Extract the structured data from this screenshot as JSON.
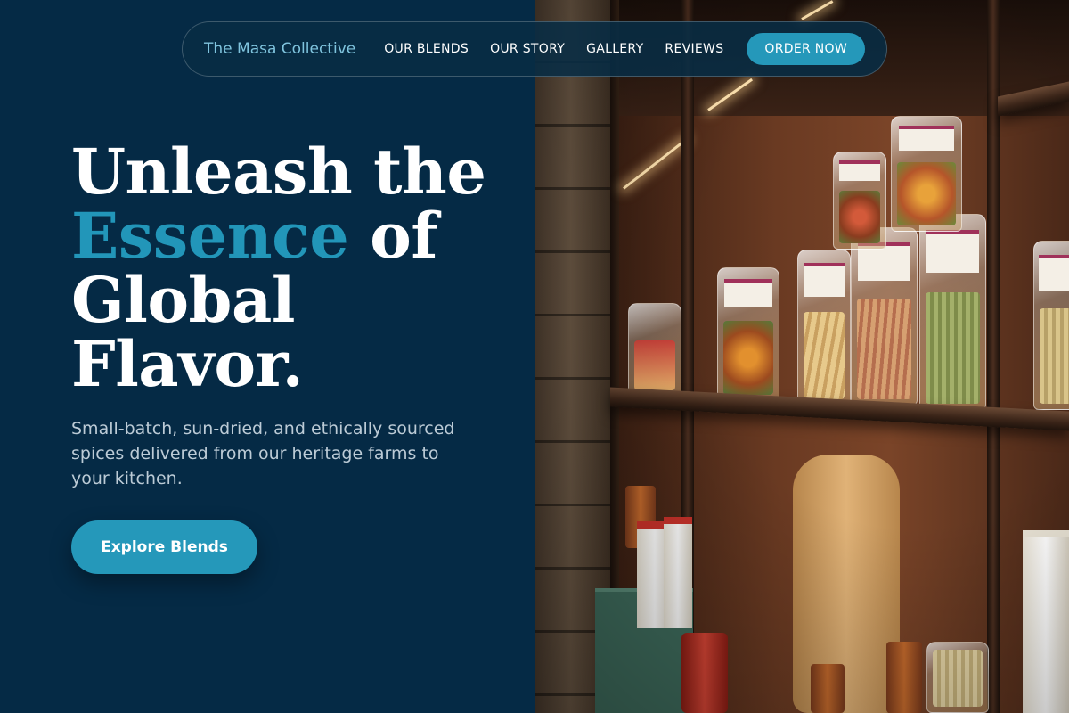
{
  "nav": {
    "brand": "The Masa Collective",
    "links": [
      "OUR BLENDS",
      "OUR STORY",
      "GALLERY",
      "REVIEWS"
    ],
    "order_label": "ORDER NOW"
  },
  "hero": {
    "headline_line1": "Unleash the",
    "headline_accent": "Essence",
    "headline_line2_rest": " of",
    "headline_line3": "Global",
    "headline_line4": "Flavor.",
    "subtitle": "Small-batch, sun-dried, and ethically sourced spices delivered from our heritage farms to your kitchen.",
    "cta_label": "Explore Blends"
  },
  "colors": {
    "background": "#052a45",
    "accent": "#2296b9",
    "button": "#2598ba",
    "brand_text": "#7fc4de"
  }
}
